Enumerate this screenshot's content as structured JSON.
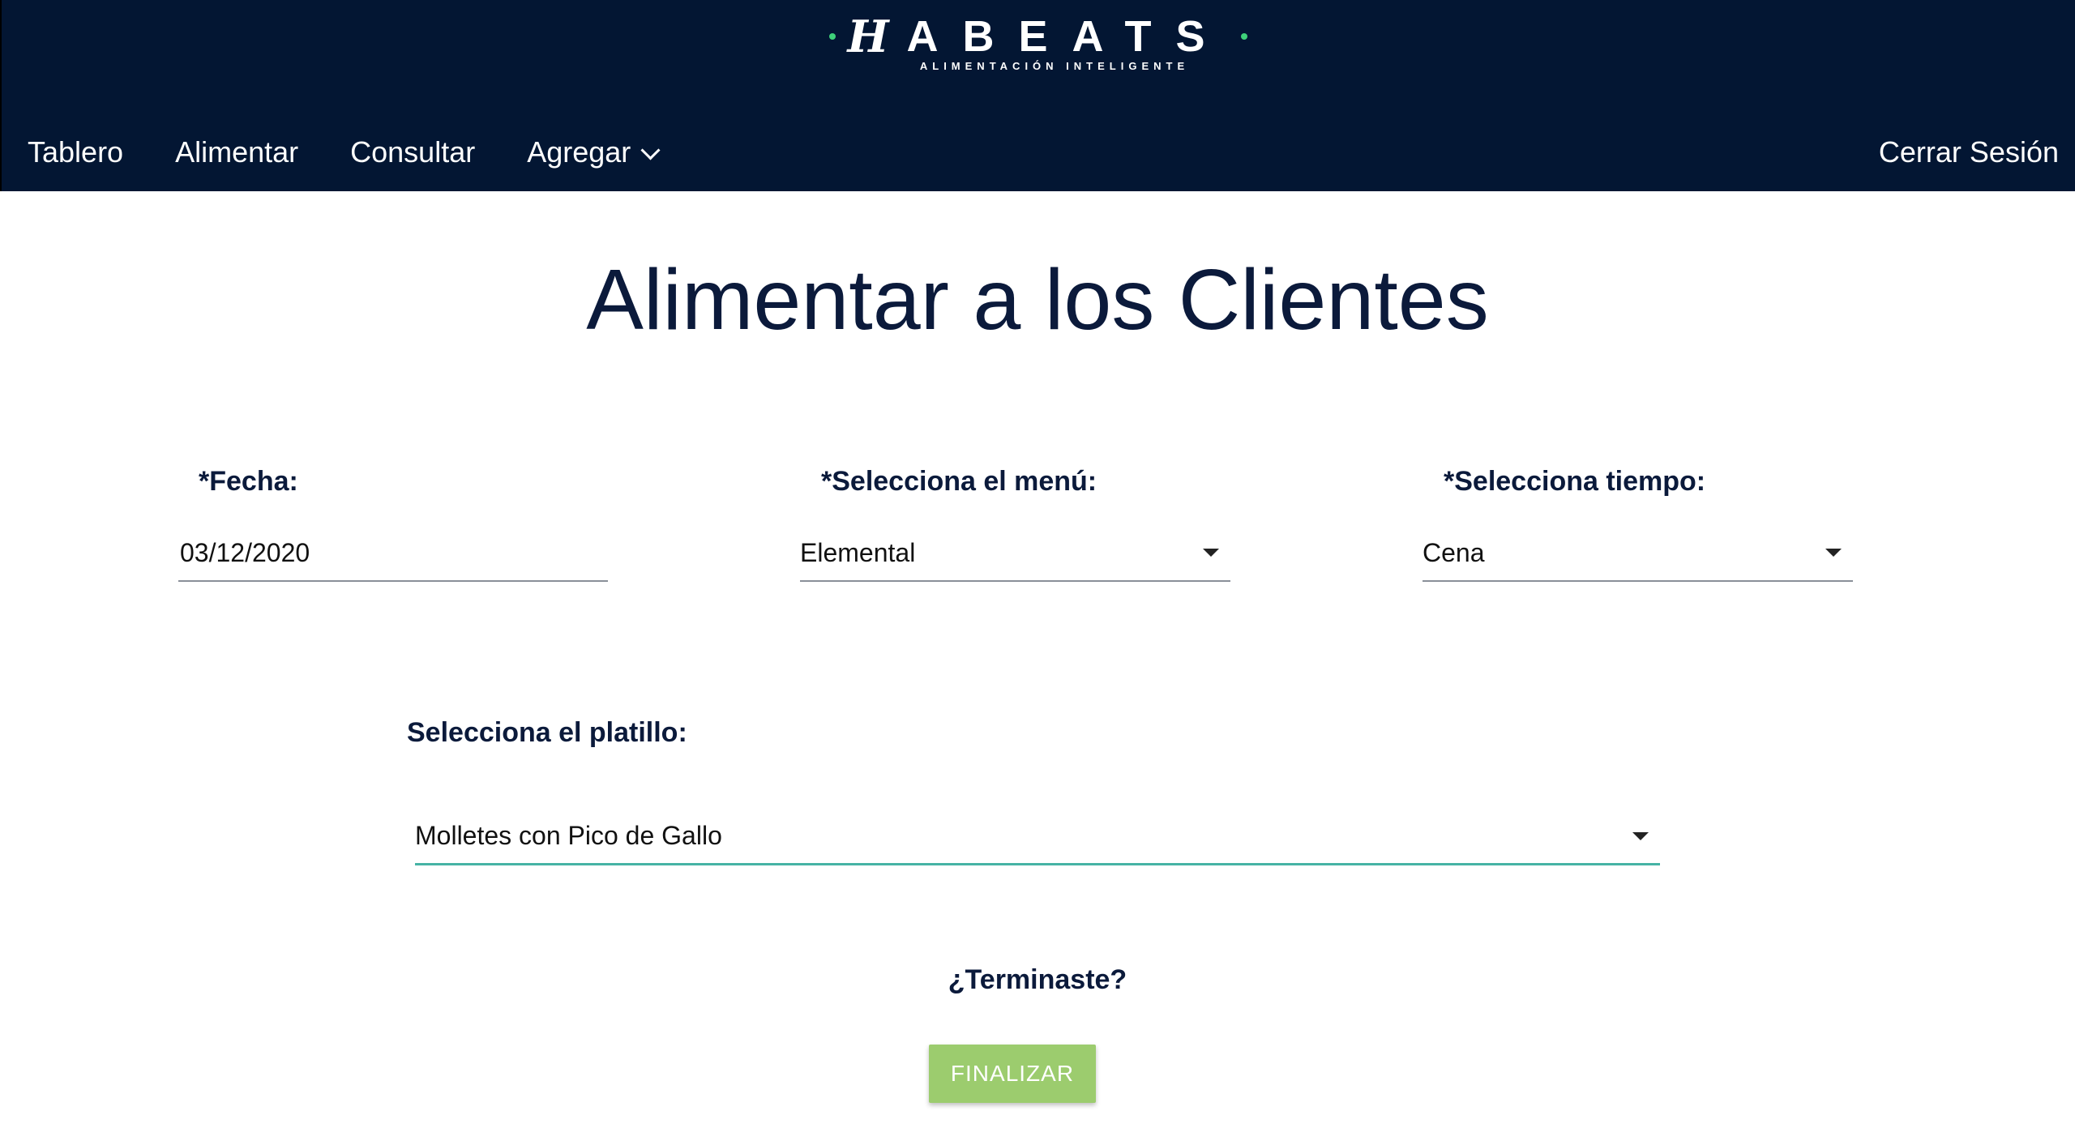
{
  "header": {
    "logo": {
      "word": "ABEATS",
      "subtitle": "ALIMENTACIÓN INTELIGENTE",
      "accent_color": "#3ed17a"
    },
    "nav": [
      {
        "label": "Tablero"
      },
      {
        "label": "Alimentar"
      },
      {
        "label": "Consultar"
      },
      {
        "label": "Agregar",
        "icon": "chevron-down-icon"
      }
    ],
    "logout_label": "Cerrar Sesión",
    "background_color": "#031633"
  },
  "page": {
    "title": "Alimentar a los Clientes"
  },
  "form": {
    "fecha": {
      "label": "*Fecha:",
      "value": "03/12/2020"
    },
    "menu": {
      "label": "*Selecciona el menú:",
      "value": "Elemental"
    },
    "tiempo": {
      "label": "*Selecciona tiempo:",
      "value": "Cena"
    },
    "platillo": {
      "label": "Selecciona el platillo:",
      "value": "Molletes con Pico de Gallo"
    }
  },
  "footer": {
    "question": "¿Terminaste?",
    "button_label": "FINALIZAR",
    "button_color": "#9ccc6e"
  }
}
